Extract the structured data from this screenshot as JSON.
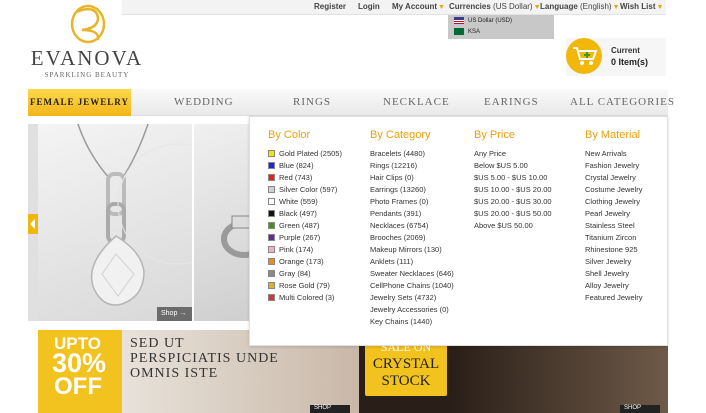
{
  "brand": {
    "name": "EVANOVA",
    "tagline": "SPARKLING BEAUTY"
  },
  "topnav": {
    "register": "Register",
    "login": "Login",
    "my_account": "My Account",
    "currencies": "Currencies",
    "currency_current": "(US Dollar)",
    "language": "Language",
    "language_current": "(English)",
    "wishlist": "Wish List"
  },
  "currency_dropdown": [
    {
      "label": "US Dollar (USD)",
      "flag": "us-flag-icon"
    },
    {
      "label": "KSA",
      "flag": "ksa-flag-icon"
    }
  ],
  "cart": {
    "label": "Current",
    "count": "0 Item(s)"
  },
  "mainnav": [
    "FEMALE JEWELRY",
    "WEDDING",
    "RINGS",
    "NECKLACE",
    "EARINGS",
    "ALL CATEGORIES"
  ],
  "banner": {
    "shop_label": "Shop"
  },
  "promos": {
    "promo1_up": "UPTO",
    "promo1_pct": "30%",
    "promo1_off": "OFF",
    "promo1_text": "SED UT PERSPICIATIS UNDE OMNIS ISTE",
    "promo1_shop": "SHOP",
    "promo2_a": "SALE ON",
    "promo2_b": "CRYSTAL",
    "promo2_c": "STOCK",
    "promo3_shop": "SHOP"
  },
  "mega_menu": {
    "by_color": {
      "title": "By Color",
      "items": [
        {
          "label": "Gold Plated (2505)",
          "color": "#f2e400"
        },
        {
          "label": "Blue (824)",
          "color": "#1f25d8"
        },
        {
          "label": "Red (743)",
          "color": "#e3201c"
        },
        {
          "label": "Silver Color (597)",
          "color": "#c9d3d2"
        },
        {
          "label": "White (559)",
          "color": "#ffffff"
        },
        {
          "label": "Black (497)",
          "color": "#111111"
        },
        {
          "label": "Green (487)",
          "color": "#4c8c1e"
        },
        {
          "label": "Purple (267)",
          "color": "#6a2b8e"
        },
        {
          "label": "Pink (174)",
          "color": "#f0b2c6"
        },
        {
          "label": "Orange (173)",
          "color": "#f08a18"
        },
        {
          "label": "Gray (84)",
          "color": "#8a8a8a"
        },
        {
          "label": "Rose Gold (79)",
          "color": "#d9b02c"
        },
        {
          "label": "Multi Colored (3)",
          "color": "#d2363c"
        }
      ]
    },
    "by_category": {
      "title": "By Category",
      "items": [
        "Bracelets (4480)",
        "Rings (12216)",
        "Hair Clips (0)",
        "Earrings (13260)",
        "Photo Frames (0)",
        "Pendants (391)",
        "Necklaces (6754)",
        "Brooches (2069)",
        "Makeup Mirrors (130)",
        "Anklets (111)",
        "Sweater Necklaces (646)",
        "CellPhone Chains (1040)",
        "Jewelry Sets (4732)",
        "Jewelry Accessories (0)",
        "Key Chains (1440)"
      ]
    },
    "by_price": {
      "title": "By Price",
      "items": [
        "Any Price",
        "Below $US 5.00",
        "$US 5.00 - $US 10.00",
        "$US 10.00 - $US 20.00",
        "$US 20.00 - $US 30.00",
        "$US 20.00 - $US 50.00",
        "Above $US 50.00"
      ]
    },
    "by_material": {
      "title": "By Material",
      "items": [
        "New Arrivals",
        "Fashion Jewelry",
        "Crystal Jewelry",
        "Costume Jewelry",
        "Clothing Jewelry",
        "Pearl Jewelry",
        "Stainless Steel",
        "Titanium Zircon",
        "Rhinestone 925",
        "Silver Jewelry",
        "Shell Jewelry",
        "Alloy Jewelry",
        "Featured Jewelry"
      ]
    }
  }
}
